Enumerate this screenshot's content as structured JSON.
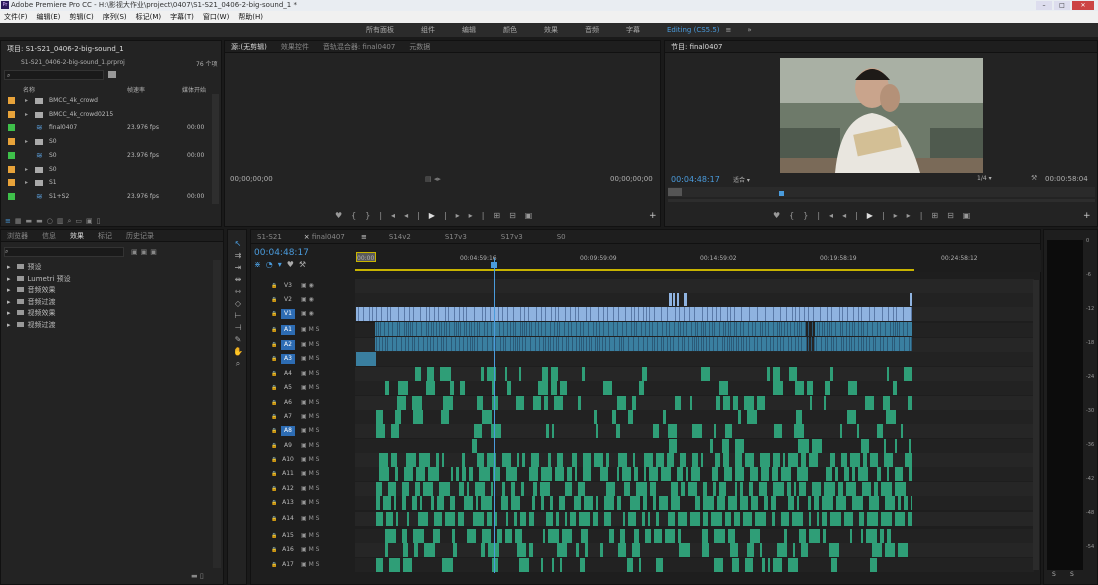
{
  "title": "Adobe Premiere Pro CC - H:\\影视大作业\\project\\0407\\S1-S21_0406-2-big-sound_1 *",
  "app_icon": "Pr",
  "menu": [
    "文件(F)",
    "编辑(E)",
    "剪辑(C)",
    "序列(S)",
    "标记(M)",
    "字幕(T)",
    "窗口(W)",
    "帮助(H)"
  ],
  "workspaces": [
    "所有面板",
    "组件",
    "编辑",
    "颜色",
    "效果",
    "音频",
    "字幕",
    "Editing (CS5.5)",
    "≡",
    "»"
  ],
  "project": {
    "title": "项目: S1-S21_0406-2-big-sound_1",
    "file": "S1-S21_0406-2-big-sound_1.prproj",
    "count": "76 个项",
    "headers": {
      "name": "名称",
      "rate": "帧速率",
      "start": "媒体开始"
    },
    "items": [
      {
        "color": "#e8a33a",
        "type": "folder",
        "name": "BMCC_4k_crowd",
        "rate": "",
        "start": ""
      },
      {
        "color": "#e8a33a",
        "type": "folder",
        "name": "BMCC_4k_crowd0215",
        "rate": "",
        "start": ""
      },
      {
        "color": "#3ec04a",
        "type": "seq",
        "name": "final0407",
        "rate": "23.976 fps",
        "start": "00:00"
      },
      {
        "color": "#e8a33a",
        "type": "folder",
        "name": "S0",
        "rate": "",
        "start": ""
      },
      {
        "color": "#3ec04a",
        "type": "seq",
        "name": "S0",
        "rate": "23.976 fps",
        "start": "00:00"
      },
      {
        "color": "#e8a33a",
        "type": "folder",
        "name": "S0",
        "rate": "",
        "start": ""
      },
      {
        "color": "#e8a33a",
        "type": "folder",
        "name": "S1",
        "rate": "",
        "start": ""
      },
      {
        "color": "#3ec04a",
        "type": "seq",
        "name": "S1+S2",
        "rate": "23.976 fps",
        "start": "00:00"
      }
    ]
  },
  "source": {
    "tabs": [
      "源:(无剪辑)",
      "效果控件",
      "音轨混合器: final0407",
      "元数据"
    ],
    "tc_left": "00;00;00;00",
    "tc_right": "00;00;00;00"
  },
  "program": {
    "tab": "节目: final0407",
    "tc": "00:04:48:17",
    "fit": "适合",
    "quality": "1/4",
    "duration": "00:00:58:04",
    "playhead_pct": 0.26
  },
  "effects": {
    "tabs": [
      "浏览器",
      "信息",
      "效果",
      "标记",
      "历史记录"
    ],
    "items": [
      "预设",
      "Lumetri 预设",
      "音频效果",
      "音频过渡",
      "视频效果",
      "视频过渡"
    ]
  },
  "timeline": {
    "tabs": [
      "S1-S21",
      "final0407",
      "S14v2",
      "S17v3",
      "S17v3",
      "S0"
    ],
    "tc": "00:04:48:17",
    "ruler": [
      "00:00",
      "00:04:59:16",
      "00:09:59:09",
      "00:14:59:02",
      "00:19:58:19",
      "00:24:58:12"
    ],
    "tracks": [
      "V3",
      "V2",
      "V1",
      "A1",
      "A2",
      "A3",
      "A4",
      "A5",
      "A6",
      "A7",
      "A8",
      "A9",
      "A10",
      "A11",
      "A12",
      "A13",
      "A14",
      "A15",
      "A16",
      "A17"
    ],
    "active_tracks": [
      "V1",
      "A1",
      "A2",
      "A3",
      "A8"
    ],
    "playhead_pct": 0.205
  },
  "meter": {
    "scale": [
      "0",
      "-6",
      "-12",
      "-18",
      "-24",
      "-30",
      "-36",
      "-42",
      "-48",
      "-54"
    ],
    "solo": [
      "S",
      "S"
    ]
  },
  "colors": {
    "accent": "#4a9bdc",
    "video": "#8fb3e0",
    "audio": "#2f9e77",
    "workarea": "#c8b400"
  }
}
